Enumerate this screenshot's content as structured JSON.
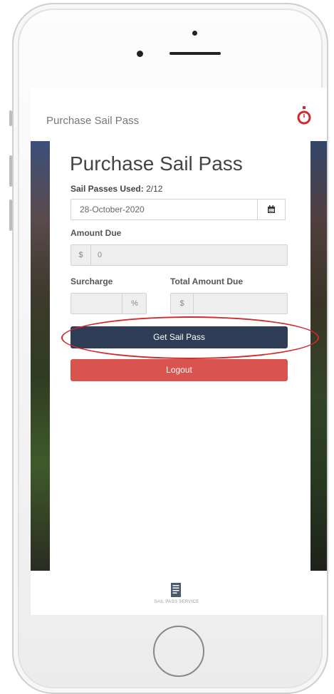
{
  "header": {
    "title": "Purchase Sail Pass"
  },
  "form": {
    "heading": "Purchase Sail Pass",
    "passes_used_label": "Sail Passes Used:",
    "passes_used_value": "2/12",
    "date_value": "28-October-2020",
    "amount_due_label": "Amount Due",
    "amount_currency": "$",
    "amount_value": "0",
    "surcharge_label": "Surcharge",
    "surcharge_unit": "%",
    "total_label": "Total Amount Due",
    "total_currency": "$"
  },
  "buttons": {
    "get_pass": "Get Sail Pass",
    "logout": "Logout"
  },
  "bottom_nav": {
    "label": "SAIL PASS SERVICE"
  },
  "colors": {
    "primary": "#2e3c55",
    "danger": "#d9534f",
    "highlight": "#d12a2a"
  },
  "icons": [
    "stopwatch-icon",
    "calendar-icon",
    "document-icon"
  ]
}
